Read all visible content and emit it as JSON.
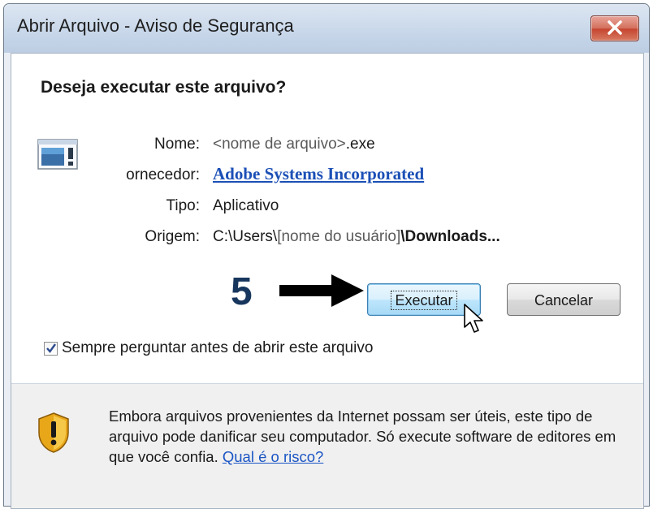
{
  "window": {
    "title": "Abrir Arquivo - Aviso de Segurança"
  },
  "dialog": {
    "question": "Deseja executar este arquivo?",
    "fields": {
      "name_label": "Nome:",
      "name_value": "<nome de arquivo>",
      "name_ext": ".exe",
      "publisher_label": "ornecedor:",
      "publisher_value": "Adobe Systems Incorporated",
      "type_label": "Tipo:",
      "type_value": "Aplicativo",
      "origin_label": "Origem:",
      "origin_prefix": "C:\\Users\\",
      "origin_user": "[nome do usuário]",
      "origin_suffix": "\\Downloads..."
    },
    "annotation": {
      "step": "5"
    },
    "buttons": {
      "run": "Executar",
      "cancel": "Cancelar"
    },
    "checkbox": {
      "label": "Sempre perguntar antes de abrir este arquivo",
      "checked": true
    },
    "warning": {
      "text": "Embora arquivos provenientes da Internet possam ser úteis, este tipo de arquivo pode danificar seu computador. Só execute software de editores em que você confia. ",
      "link": "Qual é o risco?"
    }
  },
  "icons": {
    "close": "close-icon",
    "file": "application-file-icon",
    "shield": "warning-shield-icon",
    "arrow": "right-arrow-icon",
    "cursor": "mouse-cursor-icon",
    "check": "checkmark-icon"
  },
  "colors": {
    "link": "#1b4fb6",
    "step_number": "#17365d",
    "close_button": "#c4442f"
  }
}
